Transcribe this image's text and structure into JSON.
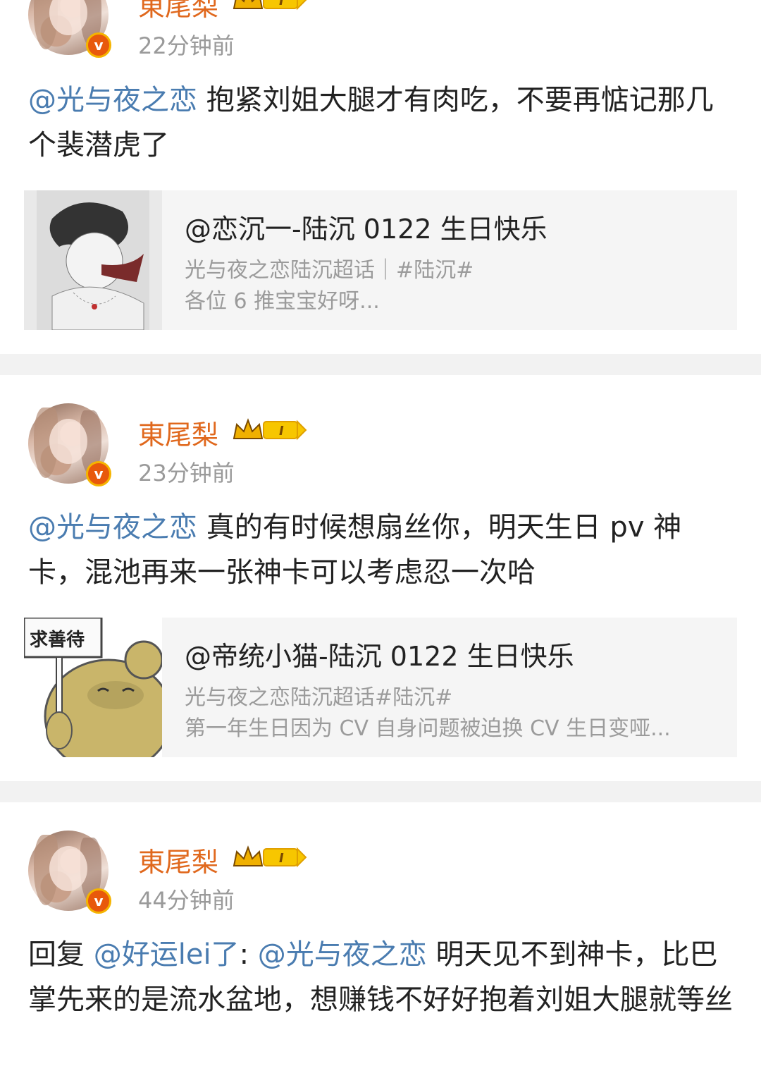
{
  "posts": [
    {
      "username": "東尾梨",
      "time": "22分钟前",
      "mention": "@光与夜之恋",
      "text": " 抱紧刘姐大腿才有肉吃，不要再惦记那几个裴潜虎了",
      "card": {
        "title": "@恋沉一-陆沉 0122 生日快乐",
        "line1": "光与夜之恋陆沉超话｜#陆沉#",
        "line2": "各位 6 推宝宝好呀..."
      }
    },
    {
      "username": "東尾梨",
      "time": "23分钟前",
      "mention": "@光与夜之恋",
      "text": " 真的有时候想扇丝你，明天生日 pv 神卡，混池再来一张神卡可以考虑忍一次哈",
      "card": {
        "thumb_label": "求善待",
        "title": "@帝统小猫-陆沉 0122 生日快乐",
        "line1": "光与夜之恋陆沉超话#陆沉#",
        "line2": "第一年生日因为 CV 自身问题被迫换 CV 生日变哑..."
      }
    },
    {
      "username": "東尾梨",
      "time": "44分钟前",
      "reply_prefix": "回复 ",
      "reply_to": "@好运lei了",
      "colon": ": ",
      "mention": "@光与夜之恋",
      "text": " 明天见不到神卡，比巴掌先来的是流水盆地，想赚钱不好好抱着刘姐大腿就等丝"
    }
  ],
  "badge": {
    "level": "I",
    "verified_mark": "v"
  },
  "colors": {
    "username": "#e0681d",
    "mention": "#4a7cb0",
    "meta": "#9a9a9a",
    "separator": "#f2f2f2"
  },
  "icons": {
    "crown": "crown-level-icon",
    "verified": "verified-badge-icon"
  }
}
